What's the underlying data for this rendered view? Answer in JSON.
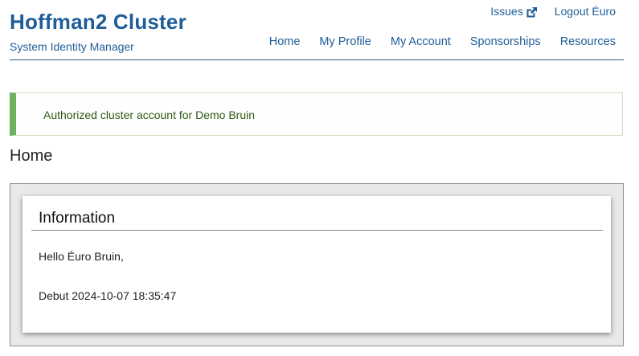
{
  "header": {
    "title": "Hoffman2 Cluster",
    "subtitle": "System Identity Manager",
    "top_links": {
      "issues": "Issues",
      "issues_icon": "external-link-icon",
      "logout": "Logout Éuro"
    },
    "nav": [
      {
        "label": "Home"
      },
      {
        "label": "My Profile"
      },
      {
        "label": "My Account"
      },
      {
        "label": "Sponsorships"
      },
      {
        "label": "Resources"
      }
    ]
  },
  "alert": {
    "message": "Authorized cluster account for Demo Bruin",
    "status": "success",
    "accent_color": "#6cb25e"
  },
  "page": {
    "heading": "Home"
  },
  "info_card": {
    "title": "Information",
    "greeting": "Hello Éuro Bruin,",
    "debut": "Debut 2024-10-07 18:35:47"
  },
  "colors": {
    "brand": "#1f5d99",
    "alert_text": "#2e5a12",
    "well_background": "#e9e9e9"
  }
}
